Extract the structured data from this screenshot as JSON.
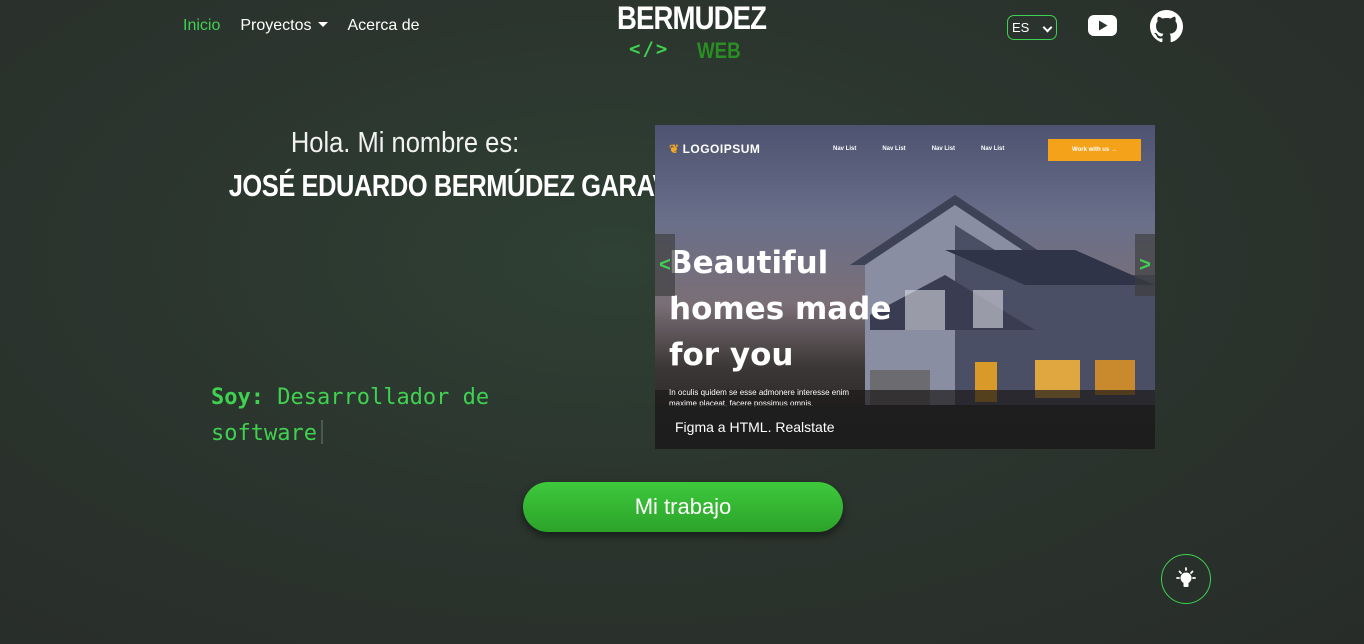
{
  "nav": {
    "items": [
      {
        "label": "Inicio",
        "active": true
      },
      {
        "label": "Proyectos",
        "dropdown": true
      },
      {
        "label": "Acerca de"
      }
    ],
    "logo": {
      "title": "BERMUDEZ",
      "code": "</>",
      "sub": "WEB"
    },
    "language": {
      "selected": "ES"
    },
    "icons": [
      "youtube-icon",
      "github-icon"
    ]
  },
  "hero": {
    "greeting": "Hola. Mi nombre es:",
    "name": "JOSÉ EDUARDO BERMÚDEZ GARAVITO",
    "role_label": "Soy:",
    "role_value": "Desarrollador de software"
  },
  "carousel": {
    "prev": "<",
    "next": ">",
    "slide": {
      "mock_logo": "LOGOIPSUM",
      "mock_links": [
        "Nav List",
        "Nav List",
        "Nav List",
        "Nav List"
      ],
      "mock_cta": "Work with us →",
      "heading": "Beautiful homes made for you",
      "text": "In oculis quidem se esse admonere interesse enim maxime placeat, facere possimus omnis.",
      "caption": "Figma a HTML. Realstate"
    }
  },
  "cta": {
    "label": "Mi trabajo"
  },
  "theme_toggle": {
    "icon": "lightbulb-icon"
  },
  "colors": {
    "accent": "#3fd14f",
    "accent_dark": "#2a8f22",
    "cta_orange": "#f5a21b"
  }
}
